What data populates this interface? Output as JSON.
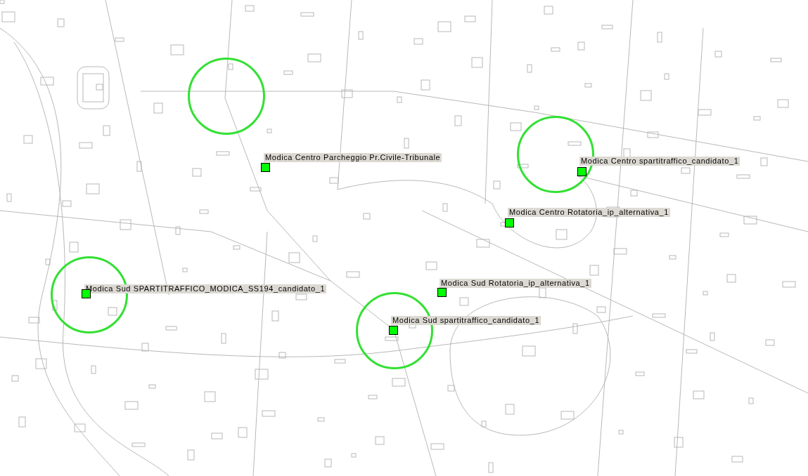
{
  "map": {
    "sites": [
      {
        "label": "Modica Centro Parcheggio Pr.Civile-Tribunale"
      },
      {
        "label": "Modica Centro spartitraffico_candidato_1"
      },
      {
        "label": "Modica Centro Rotatoria_ip_alternativa_1"
      },
      {
        "label": "Modica Sud SPARTITRAFFICO_MODICA_SS194_candidato_1"
      },
      {
        "label": "Modica Sud Rotatoria_ip_alternativa_1"
      },
      {
        "label": "Modica Sud spartitraffico_candidato_1"
      }
    ]
  }
}
